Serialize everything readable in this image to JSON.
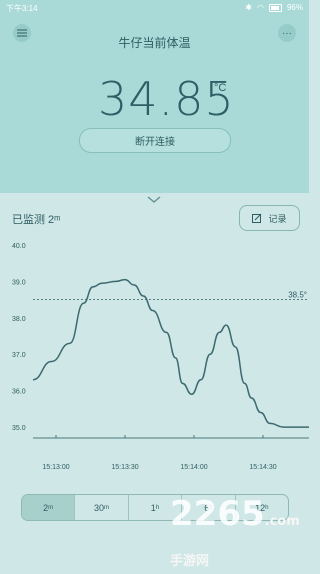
{
  "status": {
    "time": "下午3:14",
    "battery": "96%"
  },
  "header": {
    "title": "牛仔当前体温",
    "menu_icon": "list-icon",
    "more_icon": "more-icon"
  },
  "reading": {
    "value": "34.85",
    "unit": "°C"
  },
  "actions": {
    "disconnect_label": "断开连接",
    "record_label": "记录"
  },
  "monitor": {
    "label": "已监测 2ᵐ"
  },
  "chart_data": {
    "type": "line",
    "y_ticks": [
      "39.0",
      "38.0",
      "37.0",
      "36.0",
      "35.0"
    ],
    "ylim": [
      34.7,
      40.0
    ],
    "x_ticks": [
      "15:13:00",
      "15:13:30",
      "15:14:00",
      "15:14:30"
    ],
    "threshold": {
      "value": 38.5,
      "label": "38.5°"
    },
    "top_label": "40.0",
    "series": [
      {
        "points": [
          [
            0,
            36.3
          ],
          [
            8,
            36.8
          ],
          [
            16,
            37.3
          ],
          [
            22,
            38.4
          ],
          [
            26,
            38.85
          ],
          [
            30,
            38.95
          ],
          [
            36,
            39.0
          ],
          [
            40,
            39.05
          ],
          [
            44,
            38.9
          ],
          [
            48,
            38.6
          ],
          [
            52,
            38.2
          ],
          [
            58,
            37.6
          ],
          [
            62,
            36.9
          ],
          [
            65,
            36.2
          ],
          [
            69,
            35.9
          ],
          [
            73,
            36.3
          ],
          [
            77,
            37.0
          ],
          [
            81,
            37.6
          ],
          [
            84,
            37.8
          ],
          [
            88,
            37.2
          ],
          [
            92,
            36.2
          ],
          [
            95,
            35.8
          ],
          [
            99,
            35.4
          ],
          [
            103,
            35.1
          ],
          [
            109,
            35.0
          ],
          [
            120,
            35.0
          ]
        ]
      }
    ]
  },
  "ranges": [
    {
      "label": "2ᵐ",
      "active": true
    },
    {
      "label": "30ᵐ",
      "active": false
    },
    {
      "label": "1ʰ",
      "active": false
    },
    {
      "label": "6ʰ",
      "active": false
    },
    {
      "label": "12ʰ",
      "active": false
    }
  ],
  "watermark": {
    "text": "2265",
    "suffix": ".com手游网"
  }
}
